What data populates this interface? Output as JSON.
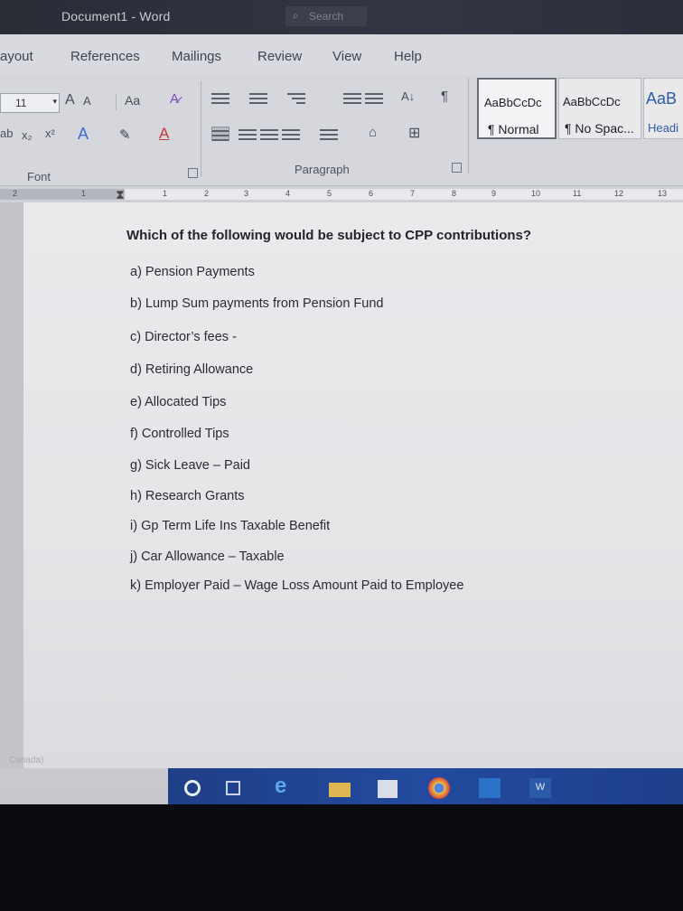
{
  "window": {
    "title": "Document1  -  Word",
    "search_placeholder": "Search"
  },
  "tabs": [
    "ayout",
    "References",
    "Mailings",
    "Review",
    "View",
    "Help"
  ],
  "ribbon": {
    "font_size": "11",
    "grow_font": "A",
    "shrink_font": "A",
    "change_case": "Aa",
    "font_group_label": "Font",
    "paragraph_group_label": "Paragraph",
    "styles": [
      {
        "sample": "AaBbCcDc",
        "name": "¶ Normal"
      },
      {
        "sample": "AaBbCcDc",
        "name": "¶ No Spac..."
      },
      {
        "sample": "AaB",
        "name": "Headi"
      }
    ]
  },
  "ruler": {
    "ticks": [
      "2",
      "1",
      "1",
      "2",
      "3",
      "4",
      "5",
      "6",
      "7",
      "8",
      "9",
      "10",
      "11",
      "12",
      "13"
    ]
  },
  "document": {
    "question": "Which of the following would be subject to CPP contributions?",
    "options": [
      "a) Pension Payments",
      "b) Lump Sum payments from Pension Fund",
      "c) Director’s fees -",
      "d) Retiring Allowance",
      "e) Allocated Tips",
      "f) Controlled Tips",
      "g) Sick Leave – Paid",
      "h) Research Grants",
      "i) Gp Term Life Ins Taxable Benefit",
      "j) Car Allowance – Taxable",
      "k) Employer Paid – Wage Loss Amount Paid to Employee"
    ]
  },
  "status": {
    "language": "Canada)"
  },
  "colors": {
    "titlebar": "#2f323d",
    "taskbar": "#234a9e",
    "page": "#e8e8eb"
  },
  "taskbar_icons": [
    "cortana-circle-icon",
    "task-view-icon",
    "edge-icon",
    "file-explorer-icon",
    "store-icon",
    "chrome-icon",
    "outlook-icon",
    "word-icon"
  ]
}
